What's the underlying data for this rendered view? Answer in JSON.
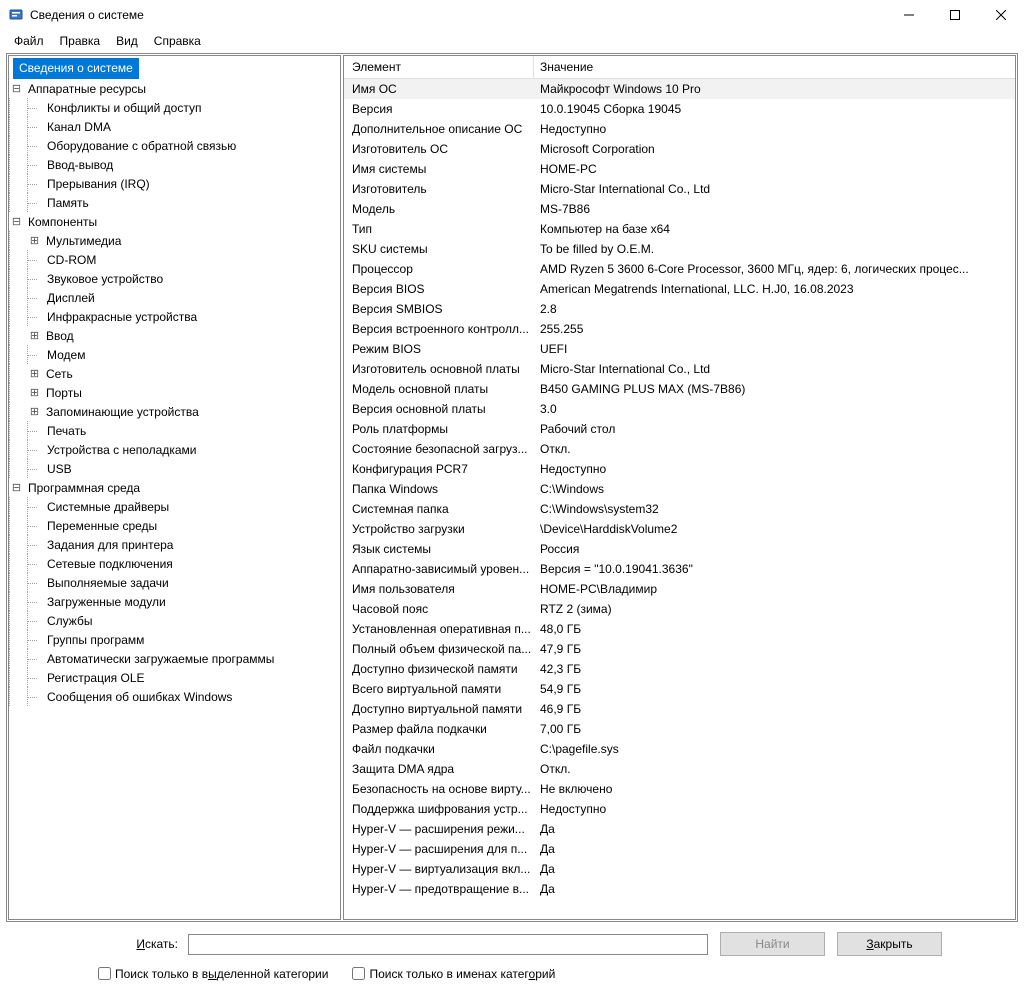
{
  "window": {
    "title": "Сведения о системе"
  },
  "menu": {
    "file": "Файл",
    "edit": "Правка",
    "view": "Вид",
    "help": "Справка"
  },
  "tree": {
    "root": "Сведения о системе",
    "hw": "Аппаратные ресурсы",
    "hw_children": [
      "Конфликты и общий доступ",
      "Канал DMA",
      "Оборудование с обратной связью",
      "Ввод-вывод",
      "Прерывания (IRQ)",
      "Память"
    ],
    "comp": "Компоненты",
    "comp_children": [
      {
        "label": "Мультимедиа",
        "expand": true
      },
      {
        "label": "CD-ROM"
      },
      {
        "label": "Звуковое устройство"
      },
      {
        "label": "Дисплей"
      },
      {
        "label": "Инфракрасные устройства"
      },
      {
        "label": "Ввод",
        "expand": true
      },
      {
        "label": "Модем"
      },
      {
        "label": "Сеть",
        "expand": true
      },
      {
        "label": "Порты",
        "expand": true
      },
      {
        "label": "Запоминающие устройства",
        "expand": true
      },
      {
        "label": "Печать"
      },
      {
        "label": "Устройства с неполадками"
      },
      {
        "label": "USB"
      }
    ],
    "sw": "Программная среда",
    "sw_children": [
      "Системные драйверы",
      "Переменные среды",
      "Задания для принтера",
      "Сетевые подключения",
      "Выполняемые задачи",
      "Загруженные модули",
      "Службы",
      "Группы программ",
      "Автоматически загружаемые программы",
      "Регистрация OLE",
      "Сообщения об ошибках Windows"
    ]
  },
  "details": {
    "header_element": "Элемент",
    "header_value": "Значение",
    "rows": [
      {
        "k": "Имя ОС",
        "v": "Майкрософт Windows 10 Pro"
      },
      {
        "k": "Версия",
        "v": "10.0.19045 Сборка 19045"
      },
      {
        "k": "Дополнительное описание ОС",
        "v": "Недоступно"
      },
      {
        "k": "Изготовитель ОС",
        "v": "Microsoft Corporation"
      },
      {
        "k": "Имя системы",
        "v": "HOME-PC"
      },
      {
        "k": "Изготовитель",
        "v": "Micro-Star International Co., Ltd"
      },
      {
        "k": "Модель",
        "v": "MS-7B86"
      },
      {
        "k": "Тип",
        "v": "Компьютер на базе x64"
      },
      {
        "k": "SKU системы",
        "v": "To be filled by O.E.M."
      },
      {
        "k": "Процессор",
        "v": "AMD Ryzen 5 3600 6-Core Processor, 3600 МГц, ядер: 6, логических процес..."
      },
      {
        "k": "Версия BIOS",
        "v": "American Megatrends International, LLC. H.J0, 16.08.2023"
      },
      {
        "k": "Версия SMBIOS",
        "v": "2.8"
      },
      {
        "k": "Версия встроенного контролл...",
        "v": "255.255"
      },
      {
        "k": "Режим BIOS",
        "v": "UEFI"
      },
      {
        "k": "Изготовитель основной платы",
        "v": "Micro-Star International Co., Ltd"
      },
      {
        "k": "Модель основной платы",
        "v": "B450 GAMING PLUS MAX (MS-7B86)"
      },
      {
        "k": "Версия основной платы",
        "v": "3.0"
      },
      {
        "k": "Роль платформы",
        "v": "Рабочий стол"
      },
      {
        "k": "Состояние безопасной загруз...",
        "v": "Откл."
      },
      {
        "k": "Конфигурация PCR7",
        "v": "Недоступно"
      },
      {
        "k": "Папка Windows",
        "v": "C:\\Windows"
      },
      {
        "k": "Системная папка",
        "v": "C:\\Windows\\system32"
      },
      {
        "k": "Устройство загрузки",
        "v": "\\Device\\HarddiskVolume2"
      },
      {
        "k": "Язык системы",
        "v": "Россия"
      },
      {
        "k": "Аппаратно-зависимый уровен...",
        "v": "Версия = \"10.0.19041.3636\""
      },
      {
        "k": "Имя пользователя",
        "v": "HOME-PC\\Владимир"
      },
      {
        "k": "Часовой пояс",
        "v": "RTZ 2 (зима)"
      },
      {
        "k": "Установленная оперативная п...",
        "v": "48,0 ГБ"
      },
      {
        "k": "Полный объем физической па...",
        "v": "47,9 ГБ"
      },
      {
        "k": "Доступно физической памяти",
        "v": "42,3 ГБ"
      },
      {
        "k": "Всего виртуальной памяти",
        "v": "54,9 ГБ"
      },
      {
        "k": "Доступно виртуальной памяти",
        "v": "46,9 ГБ"
      },
      {
        "k": "Размер файла подкачки",
        "v": "7,00 ГБ"
      },
      {
        "k": "Файл подкачки",
        "v": "C:\\pagefile.sys"
      },
      {
        "k": "Защита DMA ядра",
        "v": "Откл."
      },
      {
        "k": "Безопасность на основе вирту...",
        "v": "Не включено"
      },
      {
        "k": "Поддержка шифрования устр...",
        "v": "Недоступно"
      },
      {
        "k": "Hyper-V — расширения режи...",
        "v": "Да"
      },
      {
        "k": "Hyper-V — расширения для п...",
        "v": "Да"
      },
      {
        "k": "Hyper-V — виртуализация вкл...",
        "v": "Да"
      },
      {
        "k": "Hyper-V — предотвращение в...",
        "v": "Да"
      }
    ]
  },
  "search": {
    "label_prefix": "И",
    "label_rest": "скать:",
    "find": "Найти",
    "close_prefix": "З",
    "close_rest": "акрыть",
    "chk1_prefix": "Поиск только в в",
    "chk1_u": "ы",
    "chk1_rest": "деленной категории",
    "chk2_prefix": "Поиск только в именах катег",
    "chk2_u": "о",
    "chk2_rest": "рий"
  }
}
